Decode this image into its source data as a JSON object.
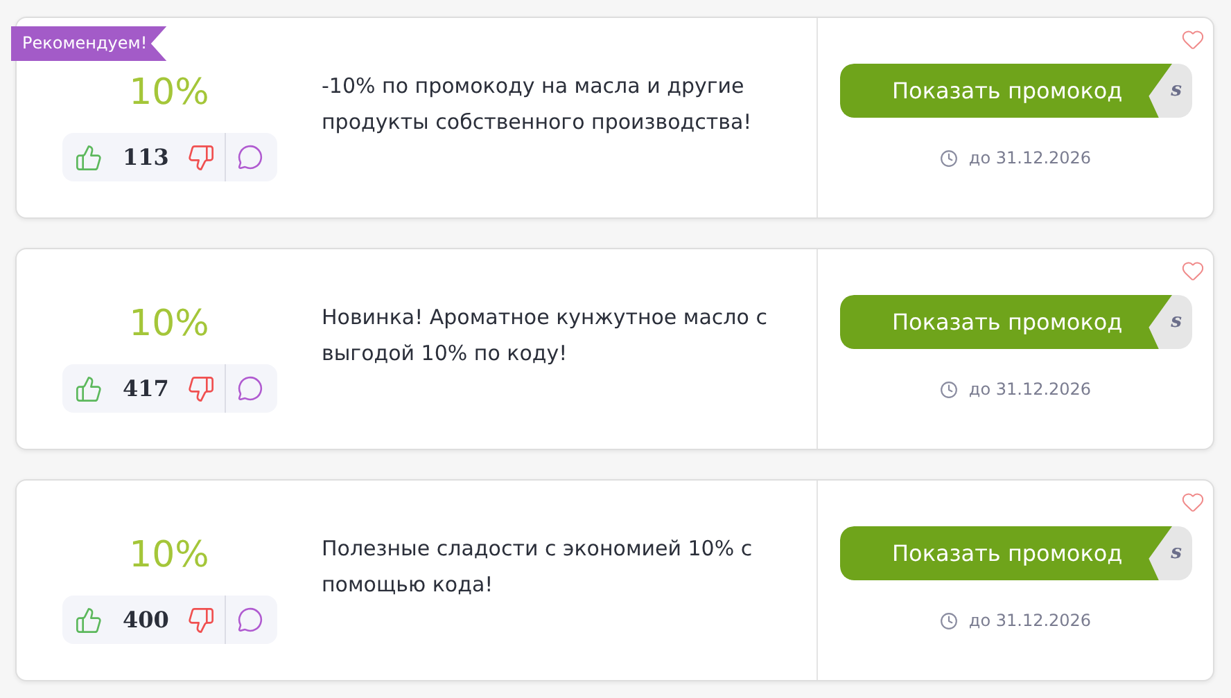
{
  "offers": [
    {
      "badge": "Рекомендуем!",
      "discount": "10%",
      "likes": "113",
      "description": "-10% по промокоду на масла и другие продукты собственного производства!",
      "button": "Показать промокод",
      "code_hint": "s",
      "expiry": "до 31.12.2026"
    },
    {
      "discount": "10%",
      "likes": "417",
      "description": "Новинка! Ароматное кунжутное масло с выгодой 10% по коду!",
      "button": "Показать промокод",
      "code_hint": "s",
      "expiry": "до 31.12.2026"
    },
    {
      "discount": "10%",
      "likes": "400",
      "description": "Полезные сладости с экономией 10% с помощью кода!",
      "button": "Показать промокод",
      "code_hint": "s",
      "expiry": "до 31.12.2026"
    }
  ]
}
